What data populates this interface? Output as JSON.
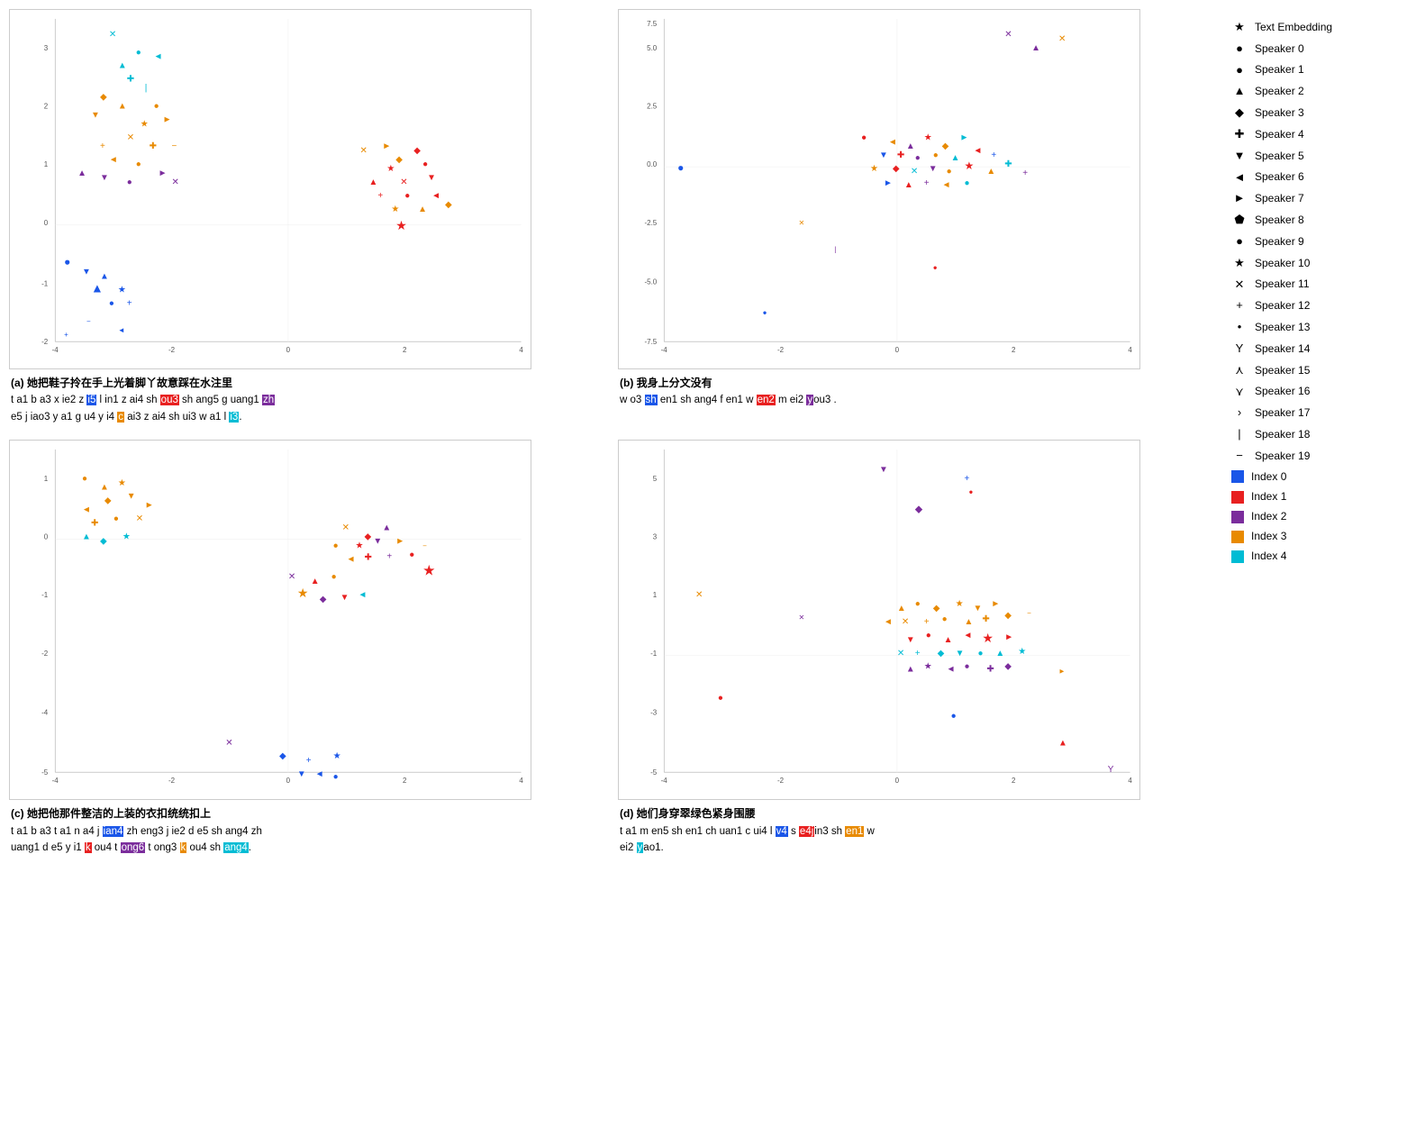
{
  "legend": {
    "items": [
      {
        "icon": "★",
        "label": "Text Embedding",
        "type": "icon"
      },
      {
        "icon": "●",
        "label": "Speaker 0",
        "type": "icon"
      },
      {
        "icon": "●",
        "label": "Speaker 1",
        "type": "icon"
      },
      {
        "icon": "▲",
        "label": "Speaker 2",
        "type": "icon"
      },
      {
        "icon": "◆",
        "label": "Speaker 3",
        "type": "icon"
      },
      {
        "icon": "✚",
        "label": "Speaker 4",
        "type": "icon"
      },
      {
        "icon": "▼",
        "label": "Speaker 5",
        "type": "icon"
      },
      {
        "icon": "◄",
        "label": "Speaker 6",
        "type": "icon"
      },
      {
        "icon": "►",
        "label": "Speaker 7",
        "type": "icon"
      },
      {
        "icon": "⬟",
        "label": "Speaker 8",
        "type": "icon"
      },
      {
        "icon": "●",
        "label": "Speaker 9",
        "type": "icon"
      },
      {
        "icon": "★",
        "label": "Speaker 10",
        "type": "icon"
      },
      {
        "icon": "✕",
        "label": "Speaker 11",
        "type": "icon"
      },
      {
        "icon": "+",
        "label": "Speaker 12",
        "type": "icon"
      },
      {
        "icon": "•",
        "label": "Speaker 13",
        "type": "icon"
      },
      {
        "icon": "Y",
        "label": "Speaker 14",
        "type": "icon"
      },
      {
        "icon": "⋏",
        "label": "Speaker 15",
        "type": "icon"
      },
      {
        "icon": "⋎",
        "label": "Speaker 16",
        "type": "icon"
      },
      {
        "icon": ">",
        "label": "Speaker 17",
        "type": "icon"
      },
      {
        "icon": "|",
        "label": "Speaker 18",
        "type": "icon"
      },
      {
        "icon": "−",
        "label": "Speaker 19",
        "type": "icon"
      },
      {
        "color": "#1a56e8",
        "label": "Index 0",
        "type": "color"
      },
      {
        "color": "#e82020",
        "label": "Index 1",
        "type": "color"
      },
      {
        "color": "#7b2d9c",
        "label": "Index 2",
        "type": "color"
      },
      {
        "color": "#e88a00",
        "label": "Index 3",
        "type": "color"
      },
      {
        "color": "#00bcd4",
        "label": "Index 4",
        "type": "color"
      }
    ]
  },
  "plots": [
    {
      "id": "a",
      "label": "(a) 她把鞋子拎在手上光着脚丫故意踩在水注里",
      "caption_parts": [
        {
          "text": "t a1 b a3 x ie2 z "
        },
        {
          "text": "i5",
          "hl": "hl-blue"
        },
        {
          "text": " l in1 z ai4 sh "
        },
        {
          "text": "ou3",
          "hl": "hl-red"
        },
        {
          "text": " sh ang5 g uang1 "
        },
        {
          "text": "zh",
          "hl": "hl-purple"
        },
        {
          "text": "\ne5 j iao3 y a1 g u4 y i4 "
        },
        {
          "text": "c",
          "hl": "hl-orange"
        },
        {
          "text": " ai3 z ai4 sh ui3 w a1 l "
        },
        {
          "text": "i3",
          "hl": "hl-cyan"
        },
        {
          "text": "."
        }
      ]
    },
    {
      "id": "b",
      "label": "(b) 我身上分文没有",
      "caption_parts": [
        {
          "text": "w o3 "
        },
        {
          "text": "sh",
          "hl": "hl-blue"
        },
        {
          "text": " en1 sh ang4 f en1 w "
        },
        {
          "text": "en2",
          "hl": "hl-red"
        },
        {
          "text": " m ei2 "
        },
        {
          "text": "y",
          "hl": "hl-purple"
        },
        {
          "text": "ou3"
        },
        {
          "text": "."
        }
      ]
    },
    {
      "id": "c",
      "label": "(c) 她把他那件整洁的上装的衣扣统统扣上",
      "caption_parts": [
        {
          "text": "t a1 b a3 t a1 n a4 j "
        },
        {
          "text": "ian4",
          "hl": "hl-blue"
        },
        {
          "text": " zh eng3 j ie2 d e5 sh ang4 zh\nuang1 d e5 y i1 "
        },
        {
          "text": "k",
          "hl": "hl-red"
        },
        {
          "text": " ou4 t "
        },
        {
          "text": "ong6",
          "hl": "hl-purple"
        },
        {
          "text": " t ong3 "
        },
        {
          "text": "k",
          "hl": "hl-orange"
        },
        {
          "text": " ou4 sh "
        },
        {
          "text": "ang4",
          "hl": "hl-cyan"
        },
        {
          "text": "."
        }
      ]
    },
    {
      "id": "d",
      "label": "(d) 她们身穿翠绿色紧身围腰",
      "caption_parts": [
        {
          "text": "t a1 m en5 sh en1 ch uan1 c ui4 l "
        },
        {
          "text": "v4",
          "hl": "hl-blue"
        },
        {
          "text": " s "
        },
        {
          "text": "e4j",
          "hl": "hl-red"
        },
        {
          "text": "in3 sh "
        },
        {
          "text": "en1",
          "hl": "hl-orange"
        },
        {
          "text": " w\nei2 "
        },
        {
          "text": "y",
          "hl": "hl-cyan"
        },
        {
          "text": "ao1."
        }
      ]
    }
  ]
}
